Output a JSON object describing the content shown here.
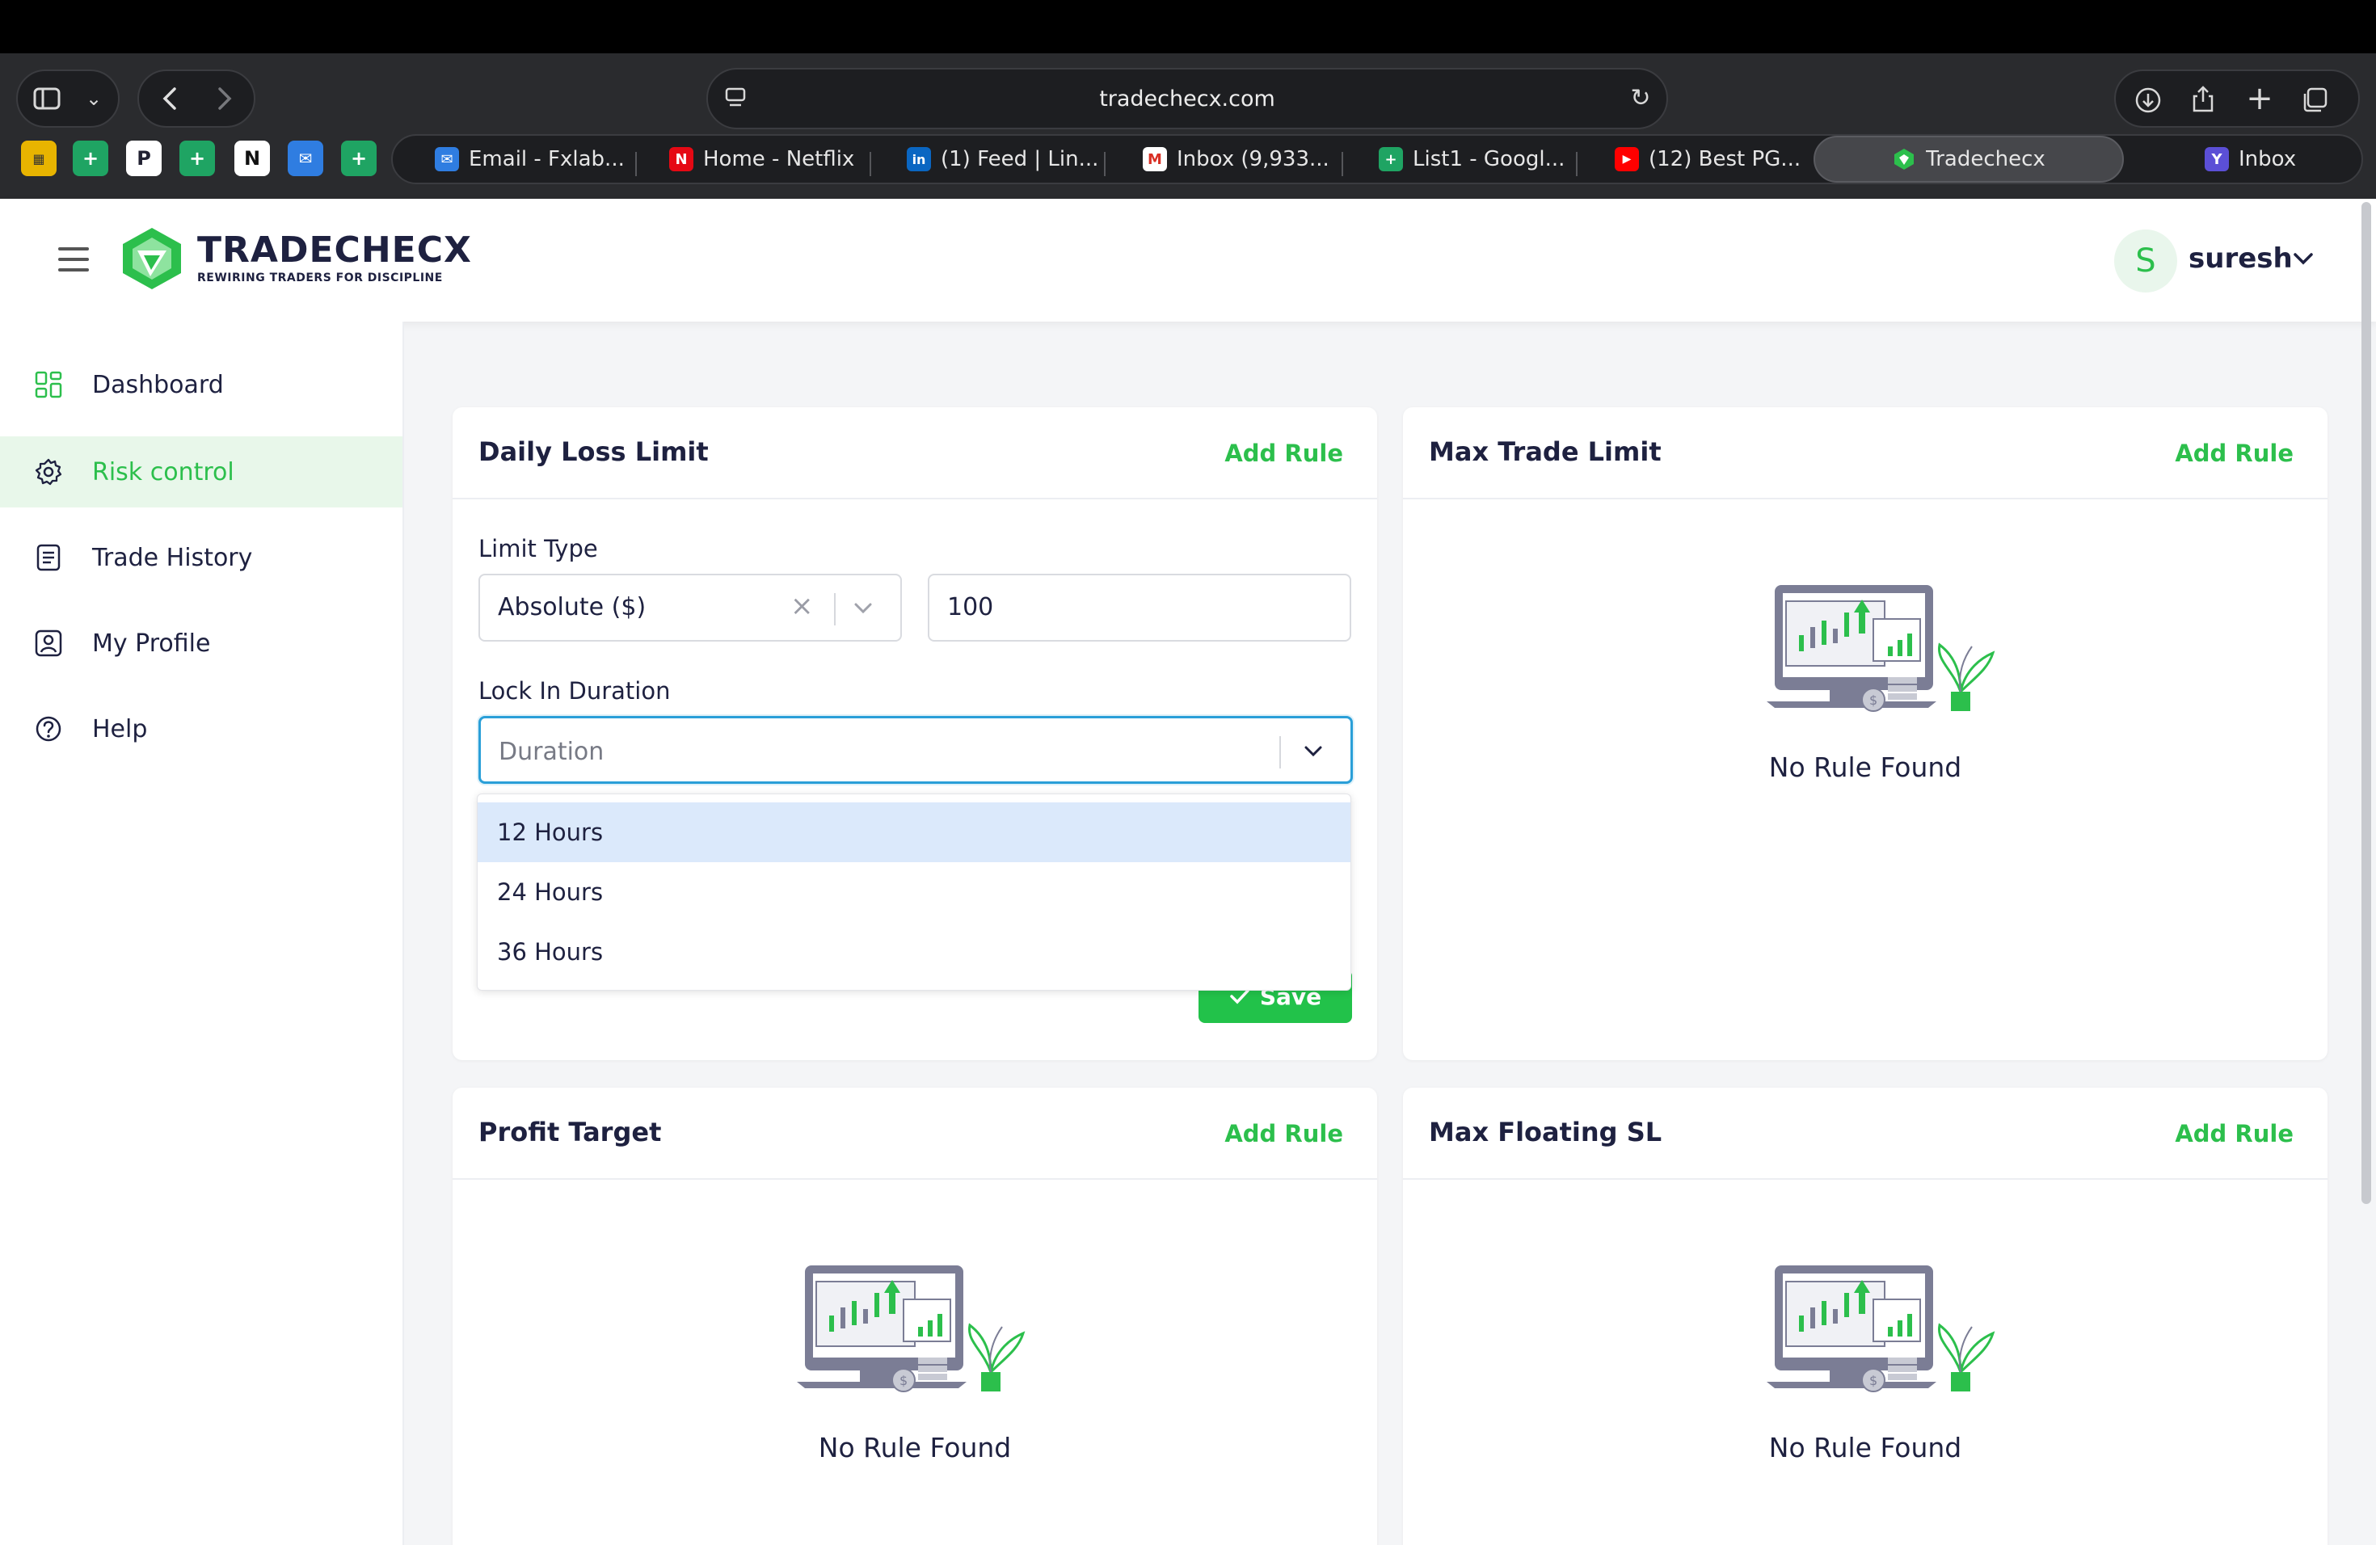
{
  "browser": {
    "url": "tradechecx.com",
    "tabs": [
      {
        "label": "Email - Fxlab...",
        "color": "#2f7de1",
        "glyph": "✉"
      },
      {
        "label": "Home - Netflix",
        "color": "#e50914",
        "glyph": "N"
      },
      {
        "label": "(1) Feed | Lin...",
        "color": "#0a66c2",
        "glyph": "in"
      },
      {
        "label": "Inbox (9,933...",
        "color": "#ffffff",
        "glyph": "M"
      },
      {
        "label": "List1 - Googl...",
        "color": "#1fa463",
        "glyph": "+"
      },
      {
        "label": "(12) Best PG...",
        "color": "#ff0000",
        "glyph": "▶"
      },
      {
        "label": "Tradechecx",
        "color": "#2cbf4c",
        "glyph": "◆"
      },
      {
        "label": "Inbox",
        "color": "#5b4fd6",
        "glyph": "Y"
      }
    ]
  },
  "app": {
    "brand": "TRADECHECX",
    "tagline": "REWIRING TRADERS FOR DISCIPLINE",
    "user": {
      "initial": "S",
      "name": "suresh"
    }
  },
  "sidebar": {
    "items": [
      {
        "label": "Dashboard"
      },
      {
        "label": "Risk control"
      },
      {
        "label": "Trade History"
      },
      {
        "label": "My Profile"
      },
      {
        "label": "Help"
      }
    ]
  },
  "cards": {
    "daily_loss": {
      "title": "Daily Loss Limit",
      "action": "Add Rule",
      "limit_type_label": "Limit Type",
      "limit_type_value": "Absolute ($)",
      "limit_amount": "100",
      "lock_label": "Lock In Duration",
      "duration_placeholder": "Duration",
      "duration_options": [
        "12 Hours",
        "24 Hours",
        "36 Hours"
      ],
      "save_label": "Save"
    },
    "max_trade": {
      "title": "Max Trade Limit",
      "action": "Add Rule",
      "empty": "No Rule Found"
    },
    "profit_target": {
      "title": "Profit Target",
      "action": "Add Rule",
      "empty": "No Rule Found"
    },
    "max_floating": {
      "title": "Max Floating SL",
      "action": "Add Rule",
      "empty": "No Rule Found"
    }
  },
  "colors": {
    "accent": "#2cbf4c",
    "focus": "#2a9fd8",
    "navy": "#1e2140"
  }
}
